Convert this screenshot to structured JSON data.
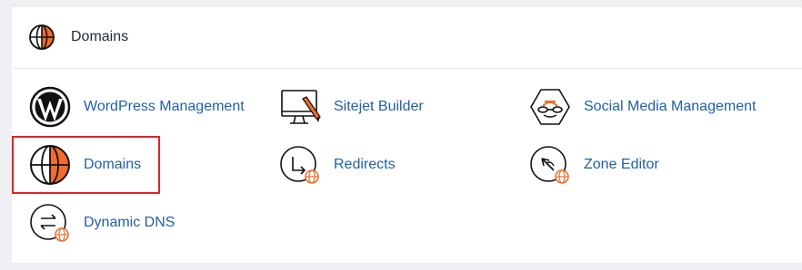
{
  "section": {
    "title": "Domains",
    "icon": "globe-icon"
  },
  "items": [
    {
      "label": "WordPress Management",
      "icon": "wordpress-icon"
    },
    {
      "label": "Sitejet Builder",
      "icon": "sitejet-builder-icon"
    },
    {
      "label": "Social Media Management",
      "icon": "social-media-icon"
    },
    {
      "label": "Domains",
      "icon": "globe-icon"
    },
    {
      "label": "Redirects",
      "icon": "redirect-icon"
    },
    {
      "label": "Zone Editor",
      "icon": "zone-editor-icon"
    },
    {
      "label": "Dynamic DNS",
      "icon": "dynamic-dns-icon"
    }
  ],
  "colors": {
    "link": "#215fa6",
    "accent": "#f06c2d",
    "highlight_border": "#e52124"
  }
}
